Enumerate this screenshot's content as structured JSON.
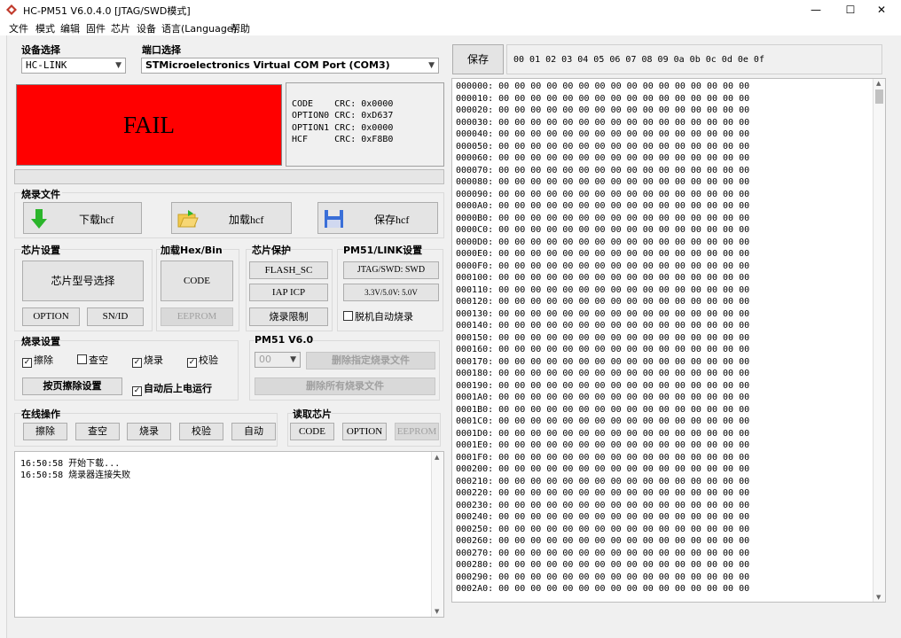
{
  "window": {
    "title": "HC-PM51 V6.0.4.0   [JTAG/SWD模式]",
    "min": "—",
    "max": "☐",
    "close": "✕"
  },
  "menu": [
    "文件",
    "模式",
    "编辑",
    "固件",
    "芯片",
    "设备",
    "语言(Language)",
    "帮助"
  ],
  "device": {
    "label": "设备选择",
    "value": "HC-LINK"
  },
  "port": {
    "label": "端口选择",
    "value": "STMicroelectronics Virtual COM Port (COM3)"
  },
  "status": {
    "text": "FAIL",
    "color": "#ff0000"
  },
  "crc": [
    "CODE    CRC: 0x0000",
    "OPTION0 CRC: 0xD637",
    "OPTION1 CRC: 0x0000",
    "HCF     CRC: 0xF8B0"
  ],
  "burnfile": {
    "label": "烧录文件",
    "download": "下载hcf",
    "load": "加载hcf",
    "save": "保存hcf"
  },
  "chipset": {
    "label": "芯片设置",
    "model": "芯片型号选择",
    "option": "OPTION",
    "snid": "SN/ID"
  },
  "loadhex": {
    "label": "加载Hex/Bin",
    "code": "CODE",
    "eeprom": "EEPROM"
  },
  "protect": {
    "label": "芯片保护",
    "flash": "FLASH_SC",
    "iap": "IAP ICP",
    "limit": "烧录限制"
  },
  "pm51link": {
    "label": "PM51/LINK设置",
    "jtag": "JTAG/SWD: SWD",
    "volt": "3.3V/5.0V: 5.0V",
    "offline": "脱机自动烧录"
  },
  "burnset": {
    "label": "烧录设置",
    "erase": "擦除",
    "check": "查空",
    "burn": "烧录",
    "verify": "校验",
    "page": "按页擦除设置",
    "autorun": "自动后上电运行"
  },
  "pm51v6": {
    "label": "PM51 V6.0",
    "select": "00",
    "del_one": "删除指定烧录文件",
    "del_all": "删除所有烧录文件"
  },
  "online": {
    "label": "在线操作",
    "buttons": [
      "擦除",
      "查空",
      "烧录",
      "校验",
      "自动"
    ]
  },
  "readchip": {
    "label": "读取芯片",
    "code": "CODE",
    "option": "OPTION",
    "eeprom": "EEPROM"
  },
  "log": [
    "16:50:58 开始下载...",
    "16:50:58 烧录器连接失败"
  ],
  "hex": {
    "save": "保存",
    "header": "00 01 02 03 04 05 06 07 08 09 0a 0b 0c 0d 0e 0f",
    "rows": [
      "000000: 00 00 00 00 00 00 00 00 00 00 00 00 00 00 00 00",
      "000010: 00 00 00 00 00 00 00 00 00 00 00 00 00 00 00 00",
      "000020: 00 00 00 00 00 00 00 00 00 00 00 00 00 00 00 00",
      "000030: 00 00 00 00 00 00 00 00 00 00 00 00 00 00 00 00",
      "000040: 00 00 00 00 00 00 00 00 00 00 00 00 00 00 00 00",
      "000050: 00 00 00 00 00 00 00 00 00 00 00 00 00 00 00 00",
      "000060: 00 00 00 00 00 00 00 00 00 00 00 00 00 00 00 00",
      "000070: 00 00 00 00 00 00 00 00 00 00 00 00 00 00 00 00",
      "000080: 00 00 00 00 00 00 00 00 00 00 00 00 00 00 00 00",
      "000090: 00 00 00 00 00 00 00 00 00 00 00 00 00 00 00 00",
      "0000A0: 00 00 00 00 00 00 00 00 00 00 00 00 00 00 00 00",
      "0000B0: 00 00 00 00 00 00 00 00 00 00 00 00 00 00 00 00",
      "0000C0: 00 00 00 00 00 00 00 00 00 00 00 00 00 00 00 00",
      "0000D0: 00 00 00 00 00 00 00 00 00 00 00 00 00 00 00 00",
      "0000E0: 00 00 00 00 00 00 00 00 00 00 00 00 00 00 00 00",
      "0000F0: 00 00 00 00 00 00 00 00 00 00 00 00 00 00 00 00",
      "000100: 00 00 00 00 00 00 00 00 00 00 00 00 00 00 00 00",
      "000110: 00 00 00 00 00 00 00 00 00 00 00 00 00 00 00 00",
      "000120: 00 00 00 00 00 00 00 00 00 00 00 00 00 00 00 00",
      "000130: 00 00 00 00 00 00 00 00 00 00 00 00 00 00 00 00",
      "000140: 00 00 00 00 00 00 00 00 00 00 00 00 00 00 00 00",
      "000150: 00 00 00 00 00 00 00 00 00 00 00 00 00 00 00 00",
      "000160: 00 00 00 00 00 00 00 00 00 00 00 00 00 00 00 00",
      "000170: 00 00 00 00 00 00 00 00 00 00 00 00 00 00 00 00",
      "000180: 00 00 00 00 00 00 00 00 00 00 00 00 00 00 00 00",
      "000190: 00 00 00 00 00 00 00 00 00 00 00 00 00 00 00 00",
      "0001A0: 00 00 00 00 00 00 00 00 00 00 00 00 00 00 00 00",
      "0001B0: 00 00 00 00 00 00 00 00 00 00 00 00 00 00 00 00",
      "0001C0: 00 00 00 00 00 00 00 00 00 00 00 00 00 00 00 00",
      "0001D0: 00 00 00 00 00 00 00 00 00 00 00 00 00 00 00 00",
      "0001E0: 00 00 00 00 00 00 00 00 00 00 00 00 00 00 00 00",
      "0001F0: 00 00 00 00 00 00 00 00 00 00 00 00 00 00 00 00",
      "000200: 00 00 00 00 00 00 00 00 00 00 00 00 00 00 00 00",
      "000210: 00 00 00 00 00 00 00 00 00 00 00 00 00 00 00 00",
      "000220: 00 00 00 00 00 00 00 00 00 00 00 00 00 00 00 00",
      "000230: 00 00 00 00 00 00 00 00 00 00 00 00 00 00 00 00",
      "000240: 00 00 00 00 00 00 00 00 00 00 00 00 00 00 00 00",
      "000250: 00 00 00 00 00 00 00 00 00 00 00 00 00 00 00 00",
      "000260: 00 00 00 00 00 00 00 00 00 00 00 00 00 00 00 00",
      "000270: 00 00 00 00 00 00 00 00 00 00 00 00 00 00 00 00",
      "000280: 00 00 00 00 00 00 00 00 00 00 00 00 00 00 00 00",
      "000290: 00 00 00 00 00 00 00 00 00 00 00 00 00 00 00 00",
      "0002A0: 00 00 00 00 00 00 00 00 00 00 00 00 00 00 00 00"
    ]
  }
}
